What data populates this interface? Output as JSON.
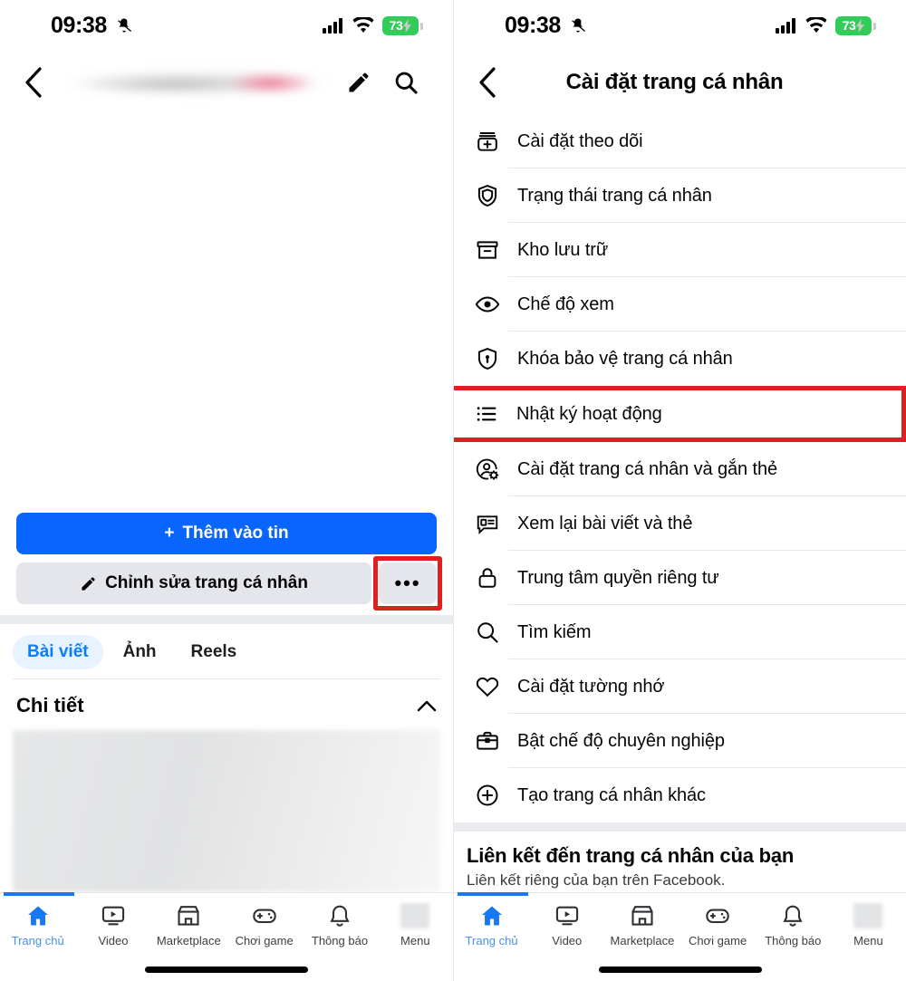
{
  "status_bar": {
    "time": "09:38",
    "icons": [
      "mute-icon",
      "cellular-signal-icon",
      "wifi-icon"
    ],
    "battery_percent": "73",
    "battery_color": "#32cd58",
    "charging": true
  },
  "left_screen": {
    "header": {
      "back_icon": "chevron-left-icon",
      "title_blurred": true,
      "edit_icon": "pencil-icon",
      "search_icon": "search-icon"
    },
    "cover_photo_blurred": true,
    "buttons": {
      "add_story_label": "Thêm vào tin",
      "add_story_prefix": "+",
      "add_story_color": "#0866ff",
      "edit_profile_label": "Chỉnh sửa trang cá nhân",
      "edit_profile_icon": "pencil-icon",
      "more_label": "•••",
      "more_highlighted": true,
      "highlight_color": "#e02020"
    },
    "tabs": [
      {
        "label": "Bài viết",
        "active": true
      },
      {
        "label": "Ảnh",
        "active": false
      },
      {
        "label": "Reels",
        "active": false
      }
    ],
    "details": {
      "title": "Chi tiết",
      "collapse_icon": "chevron-up-icon",
      "content_blurred": true
    }
  },
  "right_screen": {
    "header": {
      "back_icon": "chevron-left-icon",
      "title": "Cài đặt trang cá nhân"
    },
    "menu_items": [
      {
        "label": "Cài đặt theo dõi",
        "icon": "follow-settings-icon",
        "highlighted": false
      },
      {
        "label": "Trạng thái trang cá nhân",
        "icon": "shield-icon",
        "highlighted": false
      },
      {
        "label": "Kho lưu trữ",
        "icon": "archive-box-icon",
        "highlighted": false
      },
      {
        "label": "Chế độ xem",
        "icon": "eye-icon",
        "highlighted": false
      },
      {
        "label": "Khóa bảo vệ trang cá nhân",
        "icon": "shield-lock-icon",
        "highlighted": false
      },
      {
        "label": "Nhật ký hoạt động",
        "icon": "list-icon",
        "highlighted": true
      },
      {
        "label": "Cài đặt trang cá nhân và gắn thẻ",
        "icon": "person-gear-icon",
        "highlighted": false
      },
      {
        "label": "Xem lại bài viết và thẻ",
        "icon": "comment-review-icon",
        "highlighted": false
      },
      {
        "label": "Trung tâm quyền riêng tư",
        "icon": "lock-icon",
        "highlighted": false
      },
      {
        "label": "Tìm kiếm",
        "icon": "search-icon",
        "highlighted": false
      },
      {
        "label": "Cài đặt tường nhớ",
        "icon": "heart-icon",
        "highlighted": false
      },
      {
        "label": "Bật chế độ chuyên nghiệp",
        "icon": "briefcase-icon",
        "highlighted": false
      },
      {
        "label": "Tạo trang cá nhân khác",
        "icon": "plus-circle-icon",
        "highlighted": false
      }
    ],
    "section": {
      "heading": "Liên kết đến trang cá nhân của bạn",
      "subtitle": "Liên kết riêng của bạn trên Facebook."
    }
  },
  "bottom_nav": {
    "active_color": "#1877f2",
    "items": [
      {
        "label": "Trang chủ",
        "icon": "home-icon",
        "active": true
      },
      {
        "label": "Video",
        "icon": "video-icon",
        "active": false
      },
      {
        "label": "Marketplace",
        "icon": "marketplace-icon",
        "active": false
      },
      {
        "label": "Chơi game",
        "icon": "gamepad-icon",
        "active": false
      },
      {
        "label": "Thông báo",
        "icon": "bell-icon",
        "active": false
      },
      {
        "label": "Menu",
        "icon": "avatar-icon",
        "active": false
      }
    ]
  }
}
